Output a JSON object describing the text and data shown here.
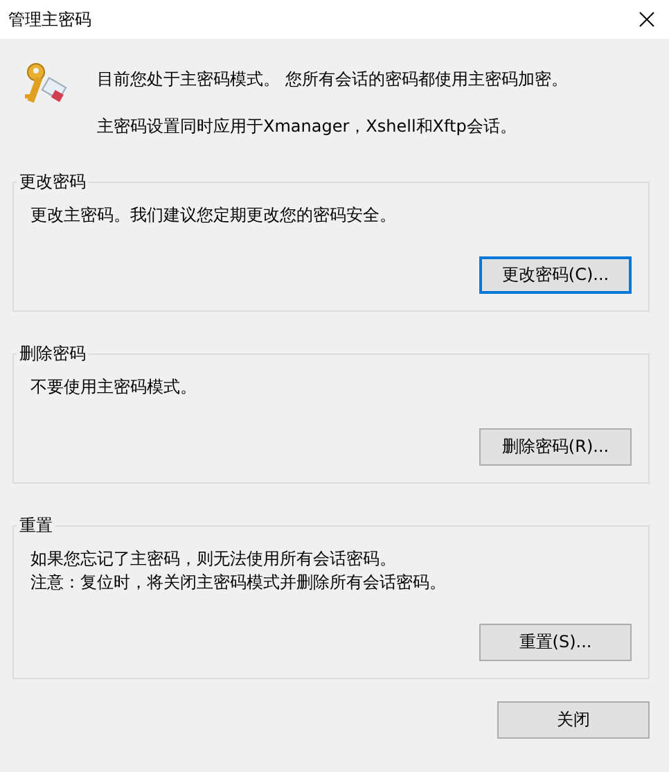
{
  "window": {
    "title": "管理主密码"
  },
  "intro": [
    "目前您处于主密码模式。 您所有会话的密码都使用主密码加密。",
    "主密码设置同时应用于Xmanager，Xshell和Xftp会话。"
  ],
  "groups": [
    {
      "title": "更改密码",
      "lines": [
        "更改主密码。我们建议您定期更改您的密码安全。"
      ],
      "button": {
        "label": "更改密码(C)...",
        "focused": true
      }
    },
    {
      "title": "删除密码",
      "lines": [
        "不要使用主密码模式。"
      ],
      "button": {
        "label": "删除密码(R)...",
        "focused": false
      }
    },
    {
      "title": "重置",
      "lines": [
        "如果您忘记了主密码，则无法使用所有会话密码。",
        "注意：复位时，将关闭主密码模式并删除所有会话密码。"
      ],
      "button": {
        "label": "重置(S)...",
        "focused": false
      }
    }
  ],
  "close_button": {
    "label": "关闭",
    "focused": false
  }
}
